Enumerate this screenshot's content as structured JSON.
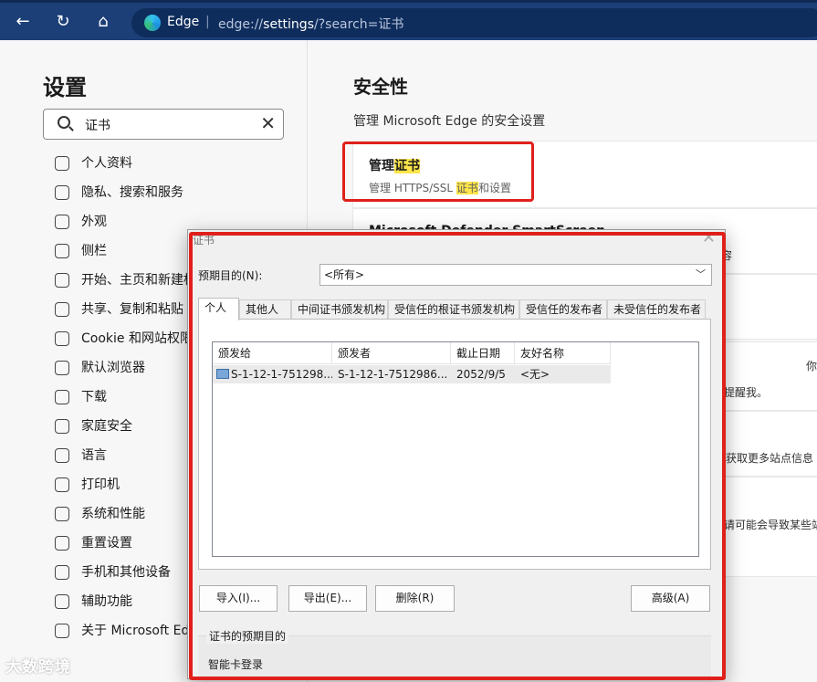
{
  "browser": {
    "tab_label": "Edge",
    "url_scheme": "edge://",
    "url_host": "settings",
    "url_path": "/?search=证书"
  },
  "sidebar": {
    "title": "设置",
    "search_value": "证书",
    "items": [
      {
        "label": "个人资料",
        "icon": "profile-icon"
      },
      {
        "label": "隐私、搜索和服务",
        "icon": "lock-icon"
      },
      {
        "label": "外观",
        "icon": "palette-icon"
      },
      {
        "label": "侧栏",
        "icon": "sidebar-icon"
      },
      {
        "label": "开始、主页和新建标签页",
        "icon": "home-icon"
      },
      {
        "label": "共享、复制和粘贴",
        "icon": "share-icon"
      },
      {
        "label": "Cookie 和网站权限",
        "icon": "cookie-icon"
      },
      {
        "label": "默认浏览器",
        "icon": "browser-icon"
      },
      {
        "label": "下载",
        "icon": "download-icon"
      },
      {
        "label": "家庭安全",
        "icon": "family-icon"
      },
      {
        "label": "语言",
        "icon": "language-icon"
      },
      {
        "label": "打印机",
        "icon": "printer-icon"
      },
      {
        "label": "系统和性能",
        "icon": "laptop-icon"
      },
      {
        "label": "重置设置",
        "icon": "reset-icon"
      },
      {
        "label": "手机和其他设备",
        "icon": "phone-icon"
      },
      {
        "label": "辅助功能",
        "icon": "accessibility-icon"
      },
      {
        "label": "关于 Microsoft Edge",
        "icon": "edge-icon"
      }
    ]
  },
  "main": {
    "section_title": "安全性",
    "section_subtitle": "管理 Microsoft Edge 的安全设置",
    "manage_cert": {
      "title_pre": "管理",
      "title_hl": "证书",
      "sub_pre": "管理 HTTPS/SSL ",
      "sub_hl": "证书",
      "sub_post": "和设置"
    },
    "defender_peek": "Microsoft Defender SmartScreen",
    "peeks": [
      "容",
      "你",
      "提醒我。",
      "获取更多站点信息",
      "请可能会导致某些站"
    ]
  },
  "dialog": {
    "title": "证书",
    "purpose_label": "预期目的(N):",
    "purpose_value": "<所有>",
    "tabs": [
      "个人",
      "其他人",
      "中间证书颁发机构",
      "受信任的根证书颁发机构",
      "受信任的发布者",
      "未受信任的发布者"
    ],
    "columns": [
      "颁发给",
      "颁发者",
      "截止日期",
      "友好名称"
    ],
    "rows": [
      {
        "issued_to": "S-1-12-1-751298...",
        "issued_by": "S-1-12-1-7512986...",
        "expires": "2052/9/5",
        "friendly": "<无>"
      }
    ],
    "buttons": {
      "import": "导入(I)...",
      "export": "导出(E)...",
      "remove": "删除(R)",
      "advanced": "高级(A)"
    },
    "purposes_group_title": "证书的预期目的",
    "purposes_value": "智能卡登录"
  },
  "watermark": "大数跨境",
  "colors": {
    "topbar": "#1c3f78",
    "highlight": "#ffe44a",
    "annotation_red": "#e0201b"
  }
}
